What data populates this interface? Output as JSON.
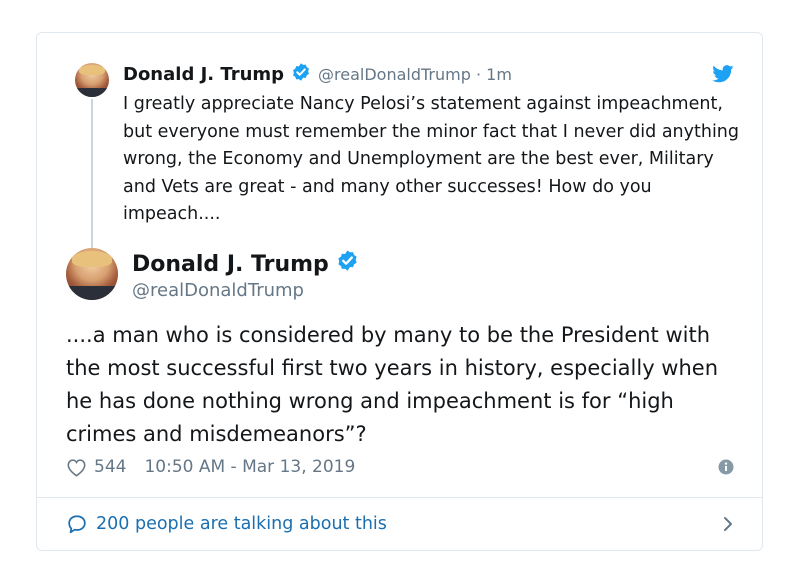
{
  "parent_tweet": {
    "author_name": "Donald J. Trump",
    "handle": "@realDonaldTrump",
    "time_sep": "·",
    "time": "1m",
    "text": "I greatly appreciate Nancy Pelosi’s statement against impeachment, but everyone must remember the minor fact that I never did anything wrong, the Economy and Unemployment are the best ever, Military and Vets are great - and many other successes! How do you impeach...."
  },
  "main_tweet": {
    "author_name": "Donald J. Trump",
    "handle": "@realDonaldTrump",
    "text": "....a man who is considered by many to be the President with the most successful first two years in history, especially when he has done nothing wrong and impeachment is for “high crimes and misdemeanors”?",
    "likes": "544",
    "timestamp": "10:50 AM - Mar 13, 2019"
  },
  "footer": {
    "talking_label": "200 people are talking about this"
  },
  "icons": {
    "verified": "verified-badge-icon",
    "bird": "twitter-bird-icon",
    "heart": "heart-icon",
    "info": "info-icon",
    "comment": "comment-bubble-icon",
    "chevron": "chevron-right-icon"
  },
  "colors": {
    "verified_blue": "#1da1f2",
    "link_blue": "#1b6fb0",
    "muted_gray": "#657786",
    "border": "#e1e8ed"
  }
}
